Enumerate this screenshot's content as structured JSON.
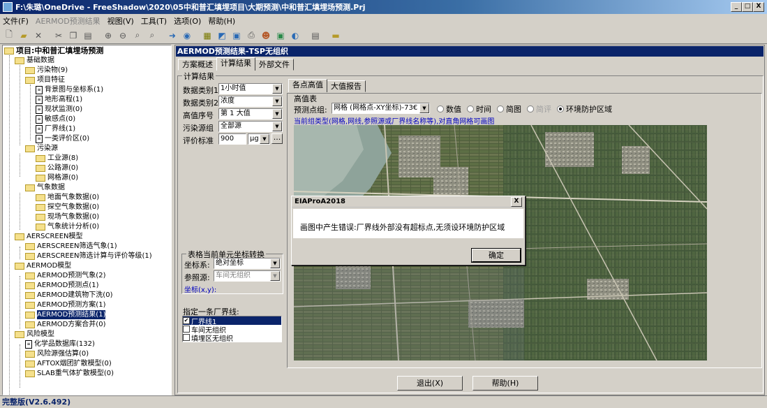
{
  "title": "F:\\朱璐\\OneDrive - FreeShadow\\2020\\05中和普汇填埋项目\\大期预测\\中和普汇填埋场预测.Prj",
  "window_buttons": {
    "min": "_",
    "max": "□",
    "close": "X"
  },
  "menu": [
    "文件(F)",
    "AERMOD预测结果",
    "视图(V)",
    "工具(T)",
    "选项(O)",
    "帮助(H)"
  ],
  "tree": {
    "root": "项目:中和普汇填埋场预测",
    "items": [
      "基础数据",
      "污染物(9)",
      "项目特征",
      "背景图与坐标系(1)",
      "地形高程(1)",
      "现状监测(0)",
      "敏感点(0)",
      "厂界线(1)",
      "一类评价区(0)",
      "污染源",
      "工业源(8)",
      "公路源(0)",
      "网格源(0)",
      "气象数据",
      "地面气象数据(0)",
      "探空气象数据(0)",
      "现场气象数据(0)",
      "气象统计分析(0)",
      "AERSCREEN模型",
      "AERSCREEN筛选气象(1)",
      "AERSCREEN筛选计算与评价等级(1)",
      "AERMOD模型",
      "AERMOD预测气象(2)",
      "AERMOD预测点(1)",
      "AERMOD建筑物下洗(0)",
      "AERMOD预测方案(1)",
      "AERMOD预测结果(1)",
      "AERMOD方案合并(0)",
      "风险模型",
      "化学品数据库(132)",
      "风险源强估算(0)",
      "AFTOX烟团扩散模型(0)",
      "SLAB重气体扩散模型(0)"
    ]
  },
  "panel": {
    "header": "AERMOD预测结果-TSP无组织",
    "tabs": [
      "方案概述",
      "计算结果",
      "外部文件"
    ],
    "calc_group": "计算结果",
    "fields": [
      {
        "label": "数据类别1",
        "value": "1小时值"
      },
      {
        "label": "数据类别2",
        "value": "浓度"
      },
      {
        "label": "高值序号",
        "value": "第 1 大值"
      },
      {
        "label": "污染源组",
        "value": "全部源"
      },
      {
        "label": "评价标准",
        "value": "900",
        "unit": "μg"
      }
    ],
    "more_btn": "...",
    "coord_group": "表格当前单元坐标转换",
    "coord_sys_label": "坐标系:",
    "coord_sys_value": "绝对坐标",
    "ref_src_label": "参照源:",
    "ref_src_value": "车间无组织",
    "coord_xy": "坐标(x,y):",
    "boundary_label": "指定一条厂界线:",
    "boundary_items": [
      "厂界线1",
      "车间无组织",
      "填埋区无组织"
    ],
    "subtabs": [
      "各点高值",
      "大值报告"
    ],
    "table_label": "高值表",
    "point_group_label": "预测点组:",
    "point_group_value": "网格 (网格点-XY坐标)-73€",
    "radios": [
      "数值",
      "时间",
      "简图",
      "简评",
      "环境防护区域"
    ],
    "hint": "当前组类型(网格,网线,参照源或厂界线名称等),对直角网格可画图",
    "exit_btn": "退出(X)",
    "help_btn": "帮助(H)"
  },
  "dialog": {
    "title": "EIAProA2018",
    "close": "X",
    "message": "画图中产生错误:厂界线外部没有超标点,无须设环境防护区域",
    "ok": "确定"
  },
  "status": "完整版(V2.6.492)"
}
